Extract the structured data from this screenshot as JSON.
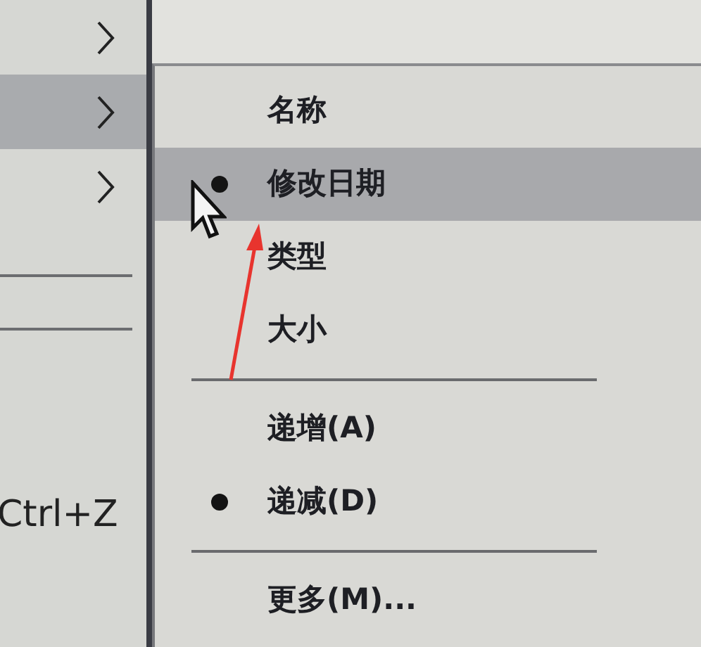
{
  "parent_menu": {
    "items": [
      {
        "kind": "submenu",
        "selected": false
      },
      {
        "kind": "submenu",
        "selected": true
      },
      {
        "kind": "submenu",
        "selected": false
      },
      {
        "kind": "separator"
      },
      {
        "kind": "separator"
      },
      {
        "kind": "shortcut",
        "shortcut": "Ctrl+Z"
      }
    ]
  },
  "sort_menu": {
    "items": [
      {
        "kind": "radio",
        "label": "名称",
        "checked": false,
        "selected": false
      },
      {
        "kind": "radio",
        "label": "修改日期",
        "checked": true,
        "selected": true
      },
      {
        "kind": "radio",
        "label": "类型",
        "checked": false,
        "selected": false
      },
      {
        "kind": "radio",
        "label": "大小",
        "checked": false,
        "selected": false
      },
      {
        "kind": "separator"
      },
      {
        "kind": "radio",
        "label": "递增(A)",
        "checked": false,
        "selected": false
      },
      {
        "kind": "radio",
        "label": "递减(D)",
        "checked": true,
        "selected": false
      },
      {
        "kind": "separator"
      },
      {
        "kind": "command",
        "label": "更多(M)..."
      }
    ]
  }
}
